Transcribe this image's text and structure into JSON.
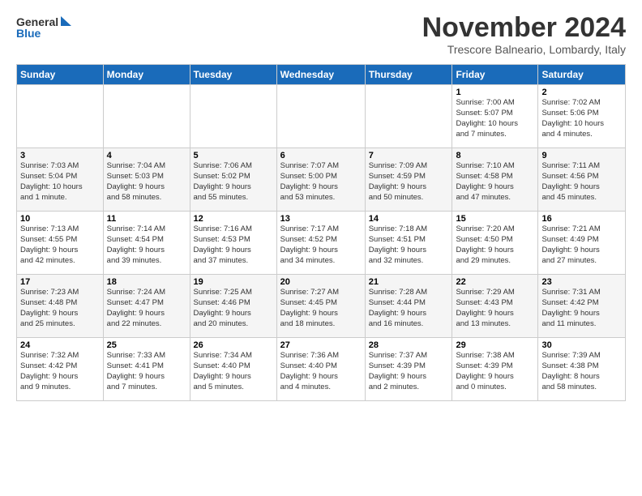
{
  "logo": {
    "line1": "General",
    "line2": "Blue"
  },
  "header": {
    "month": "November 2024",
    "location": "Trescore Balneario, Lombardy, Italy"
  },
  "weekdays": [
    "Sunday",
    "Monday",
    "Tuesday",
    "Wednesday",
    "Thursday",
    "Friday",
    "Saturday"
  ],
  "weeks": [
    [
      {
        "day": "",
        "info": ""
      },
      {
        "day": "",
        "info": ""
      },
      {
        "day": "",
        "info": ""
      },
      {
        "day": "",
        "info": ""
      },
      {
        "day": "",
        "info": ""
      },
      {
        "day": "1",
        "info": "Sunrise: 7:00 AM\nSunset: 5:07 PM\nDaylight: 10 hours\nand 7 minutes."
      },
      {
        "day": "2",
        "info": "Sunrise: 7:02 AM\nSunset: 5:06 PM\nDaylight: 10 hours\nand 4 minutes."
      }
    ],
    [
      {
        "day": "3",
        "info": "Sunrise: 7:03 AM\nSunset: 5:04 PM\nDaylight: 10 hours\nand 1 minute."
      },
      {
        "day": "4",
        "info": "Sunrise: 7:04 AM\nSunset: 5:03 PM\nDaylight: 9 hours\nand 58 minutes."
      },
      {
        "day": "5",
        "info": "Sunrise: 7:06 AM\nSunset: 5:02 PM\nDaylight: 9 hours\nand 55 minutes."
      },
      {
        "day": "6",
        "info": "Sunrise: 7:07 AM\nSunset: 5:00 PM\nDaylight: 9 hours\nand 53 minutes."
      },
      {
        "day": "7",
        "info": "Sunrise: 7:09 AM\nSunset: 4:59 PM\nDaylight: 9 hours\nand 50 minutes."
      },
      {
        "day": "8",
        "info": "Sunrise: 7:10 AM\nSunset: 4:58 PM\nDaylight: 9 hours\nand 47 minutes."
      },
      {
        "day": "9",
        "info": "Sunrise: 7:11 AM\nSunset: 4:56 PM\nDaylight: 9 hours\nand 45 minutes."
      }
    ],
    [
      {
        "day": "10",
        "info": "Sunrise: 7:13 AM\nSunset: 4:55 PM\nDaylight: 9 hours\nand 42 minutes."
      },
      {
        "day": "11",
        "info": "Sunrise: 7:14 AM\nSunset: 4:54 PM\nDaylight: 9 hours\nand 39 minutes."
      },
      {
        "day": "12",
        "info": "Sunrise: 7:16 AM\nSunset: 4:53 PM\nDaylight: 9 hours\nand 37 minutes."
      },
      {
        "day": "13",
        "info": "Sunrise: 7:17 AM\nSunset: 4:52 PM\nDaylight: 9 hours\nand 34 minutes."
      },
      {
        "day": "14",
        "info": "Sunrise: 7:18 AM\nSunset: 4:51 PM\nDaylight: 9 hours\nand 32 minutes."
      },
      {
        "day": "15",
        "info": "Sunrise: 7:20 AM\nSunset: 4:50 PM\nDaylight: 9 hours\nand 29 minutes."
      },
      {
        "day": "16",
        "info": "Sunrise: 7:21 AM\nSunset: 4:49 PM\nDaylight: 9 hours\nand 27 minutes."
      }
    ],
    [
      {
        "day": "17",
        "info": "Sunrise: 7:23 AM\nSunset: 4:48 PM\nDaylight: 9 hours\nand 25 minutes."
      },
      {
        "day": "18",
        "info": "Sunrise: 7:24 AM\nSunset: 4:47 PM\nDaylight: 9 hours\nand 22 minutes."
      },
      {
        "day": "19",
        "info": "Sunrise: 7:25 AM\nSunset: 4:46 PM\nDaylight: 9 hours\nand 20 minutes."
      },
      {
        "day": "20",
        "info": "Sunrise: 7:27 AM\nSunset: 4:45 PM\nDaylight: 9 hours\nand 18 minutes."
      },
      {
        "day": "21",
        "info": "Sunrise: 7:28 AM\nSunset: 4:44 PM\nDaylight: 9 hours\nand 16 minutes."
      },
      {
        "day": "22",
        "info": "Sunrise: 7:29 AM\nSunset: 4:43 PM\nDaylight: 9 hours\nand 13 minutes."
      },
      {
        "day": "23",
        "info": "Sunrise: 7:31 AM\nSunset: 4:42 PM\nDaylight: 9 hours\nand 11 minutes."
      }
    ],
    [
      {
        "day": "24",
        "info": "Sunrise: 7:32 AM\nSunset: 4:42 PM\nDaylight: 9 hours\nand 9 minutes."
      },
      {
        "day": "25",
        "info": "Sunrise: 7:33 AM\nSunset: 4:41 PM\nDaylight: 9 hours\nand 7 minutes."
      },
      {
        "day": "26",
        "info": "Sunrise: 7:34 AM\nSunset: 4:40 PM\nDaylight: 9 hours\nand 5 minutes."
      },
      {
        "day": "27",
        "info": "Sunrise: 7:36 AM\nSunset: 4:40 PM\nDaylight: 9 hours\nand 4 minutes."
      },
      {
        "day": "28",
        "info": "Sunrise: 7:37 AM\nSunset: 4:39 PM\nDaylight: 9 hours\nand 2 minutes."
      },
      {
        "day": "29",
        "info": "Sunrise: 7:38 AM\nSunset: 4:39 PM\nDaylight: 9 hours\nand 0 minutes."
      },
      {
        "day": "30",
        "info": "Sunrise: 7:39 AM\nSunset: 4:38 PM\nDaylight: 8 hours\nand 58 minutes."
      }
    ]
  ]
}
